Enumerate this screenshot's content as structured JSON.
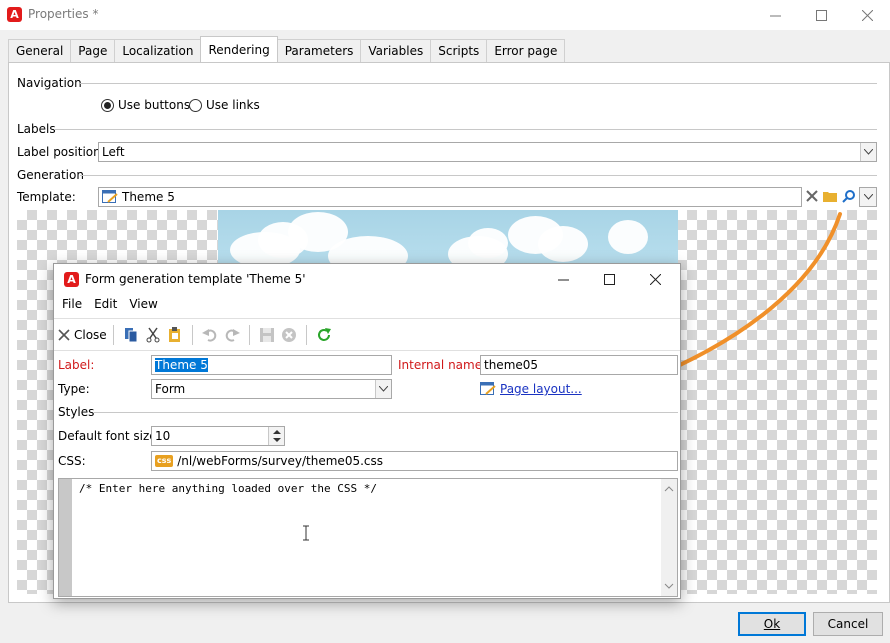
{
  "window": {
    "title": "Properties *",
    "minimize_icon": "minimize-icon",
    "maximize_icon": "maximize-icon",
    "close_icon": "close-icon"
  },
  "tabs": [
    {
      "label": "General"
    },
    {
      "label": "Page"
    },
    {
      "label": "Localization"
    },
    {
      "label": "Rendering",
      "active": true
    },
    {
      "label": "Parameters"
    },
    {
      "label": "Variables"
    },
    {
      "label": "Scripts"
    },
    {
      "label": "Error page"
    }
  ],
  "navigation": {
    "section": "Navigation",
    "option_buttons": "Use buttons",
    "option_links": "Use links",
    "selected": "Use buttons"
  },
  "labels": {
    "section": "Labels",
    "position_label": "Label position:",
    "position_value": "Left"
  },
  "generation": {
    "section": "Generation",
    "template_label": "Template:",
    "template_value": "Theme 5"
  },
  "dialog": {
    "title": "Form generation template 'Theme 5'",
    "menu": [
      "File",
      "Edit",
      "View"
    ],
    "toolbar": {
      "close_label": "Close"
    },
    "label_label": "Label:",
    "label_value": "Theme 5",
    "internal_name_label": "Internal name:",
    "internal_name_value": "theme05",
    "type_label": "Type:",
    "type_value": "Form",
    "page_layout_link": "Page layout...",
    "styles_section": "Styles",
    "font_size_label": "Default font size:",
    "font_size_value": "10",
    "css_label": "CSS:",
    "css_badge": "css",
    "css_value": "/nl/webForms/survey/theme05.css",
    "editor_text": "/* Enter here anything loaded over the CSS */"
  },
  "footer": {
    "ok_label": "Ok",
    "cancel_label": "Cancel"
  },
  "colors": {
    "accent": "#0078d7",
    "required_label": "#d0191a",
    "link": "#1a33c2",
    "arrow": "#f0902a",
    "logo": "#e21b1b"
  }
}
